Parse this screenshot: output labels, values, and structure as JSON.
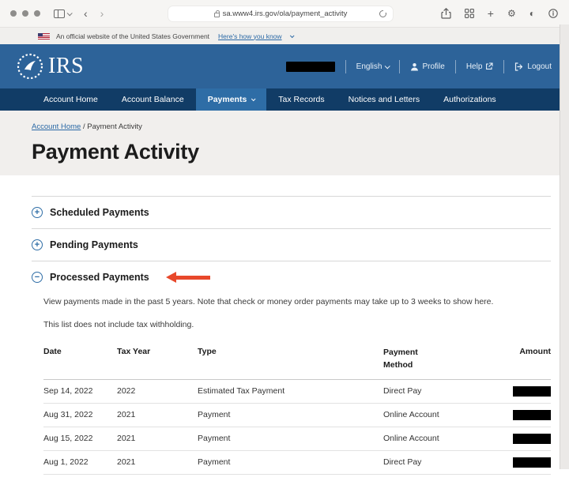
{
  "browser": {
    "url": "sa.www4.irs.gov/ola/payment_activity"
  },
  "gov_banner": {
    "text": "An official website of the United States Government",
    "link_label": "Here's how you know"
  },
  "header": {
    "logo_text": "IRS",
    "language_label": "English",
    "profile_label": "Profile",
    "help_label": "Help",
    "logout_label": "Logout",
    "username_redacted": true
  },
  "nav": {
    "items": [
      {
        "label": "Account Home",
        "active": false
      },
      {
        "label": "Account Balance",
        "active": false
      },
      {
        "label": "Payments",
        "active": true,
        "has_dropdown": true
      },
      {
        "label": "Tax Records",
        "active": false
      },
      {
        "label": "Notices and Letters",
        "active": false
      },
      {
        "label": "Authorizations",
        "active": false
      }
    ]
  },
  "breadcrumb": {
    "link_label": "Account Home",
    "separator": "/",
    "current": "Payment Activity"
  },
  "page": {
    "title": "Payment Activity"
  },
  "accordions": {
    "items": [
      {
        "label": "Scheduled Payments",
        "toggle_glyph": "+",
        "state": "collapsed"
      },
      {
        "label": "Pending Payments",
        "toggle_glyph": "+",
        "state": "collapsed"
      },
      {
        "label": "Processed Payments",
        "toggle_glyph": "−",
        "state": "expanded",
        "annotated_with_red_arrow": true
      }
    ]
  },
  "processed_payments": {
    "note_line1": "View payments made in the past 5 years. Note that check or money order payments may take up to 3 weeks to show here.",
    "note_line2": "This list does not include tax withholding.",
    "table": {
      "headers": [
        "Date",
        "Tax Year",
        "Type",
        "Payment Method",
        "Amount"
      ],
      "rows": [
        {
          "date": "Sep 14, 2022",
          "tax_year": "2022",
          "type": "Estimated Tax Payment",
          "payment_method": "Direct Pay",
          "amount_redacted": true
        },
        {
          "date": "Aug 31, 2022",
          "tax_year": "2021",
          "type": "Payment",
          "payment_method": "Online Account",
          "amount_redacted": true
        },
        {
          "date": "Aug 15, 2022",
          "tax_year": "2021",
          "type": "Payment",
          "payment_method": "Online Account",
          "amount_redacted": true
        },
        {
          "date": "Aug 1, 2022",
          "tax_year": "2021",
          "type": "Payment",
          "payment_method": "Direct Pay",
          "amount_redacted": true
        }
      ]
    }
  },
  "colors": {
    "header_blue": "#2d6399",
    "nav_navy": "#113c66",
    "active_tab_blue": "#2e6da6",
    "link_blue": "#2a68a5",
    "annotation_red": "#e8482b",
    "redaction_black": "#000000"
  }
}
